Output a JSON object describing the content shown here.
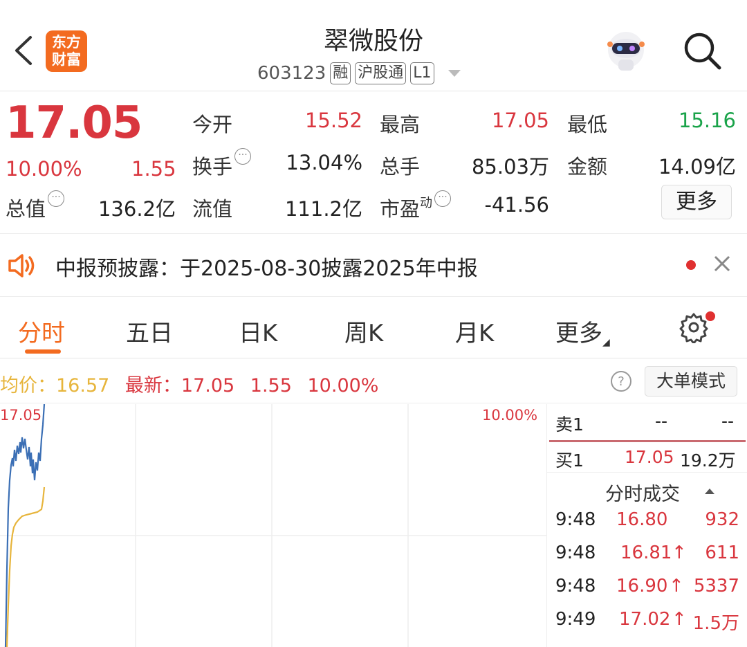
{
  "header": {
    "title": "翠微股份",
    "code": "603123",
    "tags": [
      "融",
      "沪股通",
      "L1"
    ],
    "logo_line1": "东方",
    "logo_line2": "财富"
  },
  "quote": {
    "price": "17.05",
    "change_pct": "10.00%",
    "change": "1.55",
    "total_value_label": "总值",
    "total_value": "136.2亿",
    "stats": [
      {
        "label": "今开",
        "value": "15.52"
      },
      {
        "label": "最高",
        "value": "17.05"
      },
      {
        "label": "最低",
        "value": "15.16"
      },
      {
        "label": "换手",
        "value": "13.04%"
      },
      {
        "label": "总手",
        "value": "85.03万"
      },
      {
        "label": "金额",
        "value": "14.09亿"
      },
      {
        "label": "流值",
        "value": "111.2亿"
      },
      {
        "label": "市盈",
        "value": "-41.56",
        "superscript": "动"
      }
    ],
    "more_label": "更多"
  },
  "notice": {
    "text": "中报预披露：于2025-08-30披露2025年中报"
  },
  "tabs": [
    "分时",
    "五日",
    "日K",
    "周K",
    "月K",
    "更多"
  ],
  "inforow": {
    "avg_label": "均价：",
    "avg_value": "16.57",
    "latest_label": "最新：",
    "latest_value": "17.05",
    "latest_change": "1.55",
    "latest_pct": "10.00%",
    "big_order_label": "大单模式"
  },
  "chart": {
    "y_top": "17.05",
    "pct_top": "10.00%",
    "colors": {
      "price": "#3b6fb5",
      "avg": "#e7b53c",
      "grid": "#eeeeee"
    }
  },
  "orderbook": {
    "sell": {
      "label": "卖1",
      "price": "--",
      "volume": "--"
    },
    "buy": {
      "label": "买1",
      "price": "17.05",
      "volume": "19.2万"
    }
  },
  "trades": {
    "title": "分时成交",
    "rows": [
      {
        "time": "9:48",
        "price": "16.80",
        "volume": "932",
        "arrow": ""
      },
      {
        "time": "9:48",
        "price": "16.81",
        "volume": "611",
        "arrow": "↑"
      },
      {
        "time": "9:48",
        "price": "16.90",
        "volume": "5337",
        "arrow": "↑"
      },
      {
        "time": "9:49",
        "price": "17.02",
        "volume": "1.5万",
        "arrow": "↑"
      }
    ]
  }
}
